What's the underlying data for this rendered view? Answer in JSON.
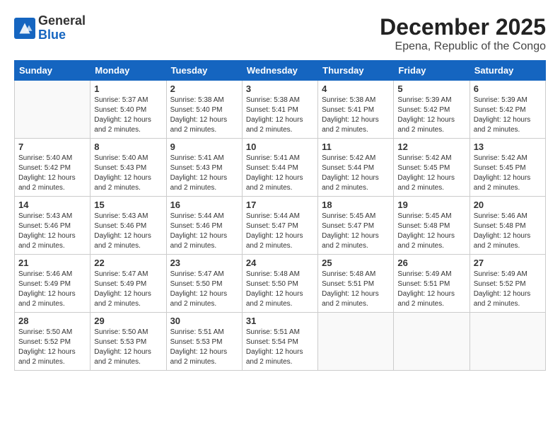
{
  "header": {
    "logo_general": "General",
    "logo_blue": "Blue",
    "month": "December 2025",
    "location": "Epena, Republic of the Congo"
  },
  "days_of_week": [
    "Sunday",
    "Monday",
    "Tuesday",
    "Wednesday",
    "Thursday",
    "Friday",
    "Saturday"
  ],
  "weeks": [
    [
      {
        "day": "",
        "empty": true
      },
      {
        "day": "1",
        "sunrise": "5:37 AM",
        "sunset": "5:40 PM",
        "daylight": "12 hours and 2 minutes."
      },
      {
        "day": "2",
        "sunrise": "5:38 AM",
        "sunset": "5:40 PM",
        "daylight": "12 hours and 2 minutes."
      },
      {
        "day": "3",
        "sunrise": "5:38 AM",
        "sunset": "5:41 PM",
        "daylight": "12 hours and 2 minutes."
      },
      {
        "day": "4",
        "sunrise": "5:38 AM",
        "sunset": "5:41 PM",
        "daylight": "12 hours and 2 minutes."
      },
      {
        "day": "5",
        "sunrise": "5:39 AM",
        "sunset": "5:42 PM",
        "daylight": "12 hours and 2 minutes."
      },
      {
        "day": "6",
        "sunrise": "5:39 AM",
        "sunset": "5:42 PM",
        "daylight": "12 hours and 2 minutes."
      }
    ],
    [
      {
        "day": "7",
        "sunrise": "5:40 AM",
        "sunset": "5:42 PM",
        "daylight": "12 hours and 2 minutes."
      },
      {
        "day": "8",
        "sunrise": "5:40 AM",
        "sunset": "5:43 PM",
        "daylight": "12 hours and 2 minutes."
      },
      {
        "day": "9",
        "sunrise": "5:41 AM",
        "sunset": "5:43 PM",
        "daylight": "12 hours and 2 minutes."
      },
      {
        "day": "10",
        "sunrise": "5:41 AM",
        "sunset": "5:44 PM",
        "daylight": "12 hours and 2 minutes."
      },
      {
        "day": "11",
        "sunrise": "5:42 AM",
        "sunset": "5:44 PM",
        "daylight": "12 hours and 2 minutes."
      },
      {
        "day": "12",
        "sunrise": "5:42 AM",
        "sunset": "5:45 PM",
        "daylight": "12 hours and 2 minutes."
      },
      {
        "day": "13",
        "sunrise": "5:42 AM",
        "sunset": "5:45 PM",
        "daylight": "12 hours and 2 minutes."
      }
    ],
    [
      {
        "day": "14",
        "sunrise": "5:43 AM",
        "sunset": "5:46 PM",
        "daylight": "12 hours and 2 minutes."
      },
      {
        "day": "15",
        "sunrise": "5:43 AM",
        "sunset": "5:46 PM",
        "daylight": "12 hours and 2 minutes."
      },
      {
        "day": "16",
        "sunrise": "5:44 AM",
        "sunset": "5:46 PM",
        "daylight": "12 hours and 2 minutes."
      },
      {
        "day": "17",
        "sunrise": "5:44 AM",
        "sunset": "5:47 PM",
        "daylight": "12 hours and 2 minutes."
      },
      {
        "day": "18",
        "sunrise": "5:45 AM",
        "sunset": "5:47 PM",
        "daylight": "12 hours and 2 minutes."
      },
      {
        "day": "19",
        "sunrise": "5:45 AM",
        "sunset": "5:48 PM",
        "daylight": "12 hours and 2 minutes."
      },
      {
        "day": "20",
        "sunrise": "5:46 AM",
        "sunset": "5:48 PM",
        "daylight": "12 hours and 2 minutes."
      }
    ],
    [
      {
        "day": "21",
        "sunrise": "5:46 AM",
        "sunset": "5:49 PM",
        "daylight": "12 hours and 2 minutes."
      },
      {
        "day": "22",
        "sunrise": "5:47 AM",
        "sunset": "5:49 PM",
        "daylight": "12 hours and 2 minutes."
      },
      {
        "day": "23",
        "sunrise": "5:47 AM",
        "sunset": "5:50 PM",
        "daylight": "12 hours and 2 minutes."
      },
      {
        "day": "24",
        "sunrise": "5:48 AM",
        "sunset": "5:50 PM",
        "daylight": "12 hours and 2 minutes."
      },
      {
        "day": "25",
        "sunrise": "5:48 AM",
        "sunset": "5:51 PM",
        "daylight": "12 hours and 2 minutes."
      },
      {
        "day": "26",
        "sunrise": "5:49 AM",
        "sunset": "5:51 PM",
        "daylight": "12 hours and 2 minutes."
      },
      {
        "day": "27",
        "sunrise": "5:49 AM",
        "sunset": "5:52 PM",
        "daylight": "12 hours and 2 minutes."
      }
    ],
    [
      {
        "day": "28",
        "sunrise": "5:50 AM",
        "sunset": "5:52 PM",
        "daylight": "12 hours and 2 minutes."
      },
      {
        "day": "29",
        "sunrise": "5:50 AM",
        "sunset": "5:53 PM",
        "daylight": "12 hours and 2 minutes."
      },
      {
        "day": "30",
        "sunrise": "5:51 AM",
        "sunset": "5:53 PM",
        "daylight": "12 hours and 2 minutes."
      },
      {
        "day": "31",
        "sunrise": "5:51 AM",
        "sunset": "5:54 PM",
        "daylight": "12 hours and 2 minutes."
      },
      {
        "day": "",
        "empty": true
      },
      {
        "day": "",
        "empty": true
      },
      {
        "day": "",
        "empty": true
      }
    ]
  ],
  "labels": {
    "sunrise_label": "Sunrise:",
    "sunset_label": "Sunset:",
    "daylight_label": "Daylight:"
  }
}
